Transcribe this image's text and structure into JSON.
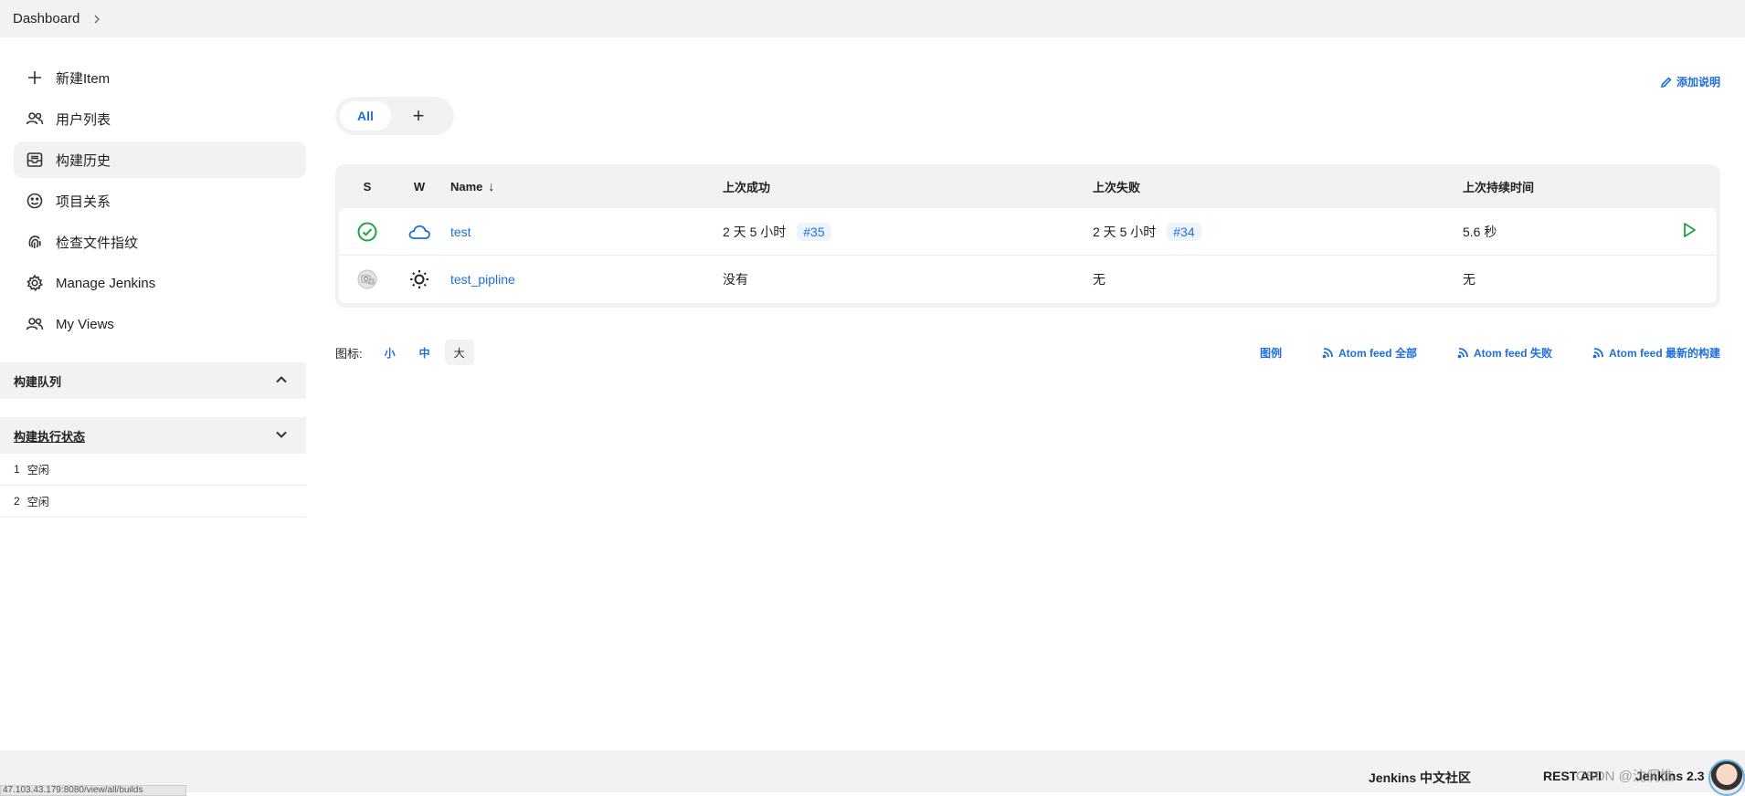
{
  "breadcrumb": {
    "root": "Dashboard",
    "separator": ">"
  },
  "sidebar": {
    "items": [
      {
        "label": "新建Item",
        "icon": "plus-icon"
      },
      {
        "label": "用户列表",
        "icon": "users-icon"
      },
      {
        "label": "构建历史",
        "icon": "inbox-icon",
        "active": true
      },
      {
        "label": "项目关系",
        "icon": "smile-icon"
      },
      {
        "label": "检查文件指纹",
        "icon": "fingerprint-icon"
      },
      {
        "label": "Manage Jenkins",
        "icon": "gear-icon"
      },
      {
        "label": "My Views",
        "icon": "users-icon"
      }
    ],
    "queue": {
      "title": "构建队列"
    },
    "executors": {
      "title": "构建执行状态",
      "rows": [
        {
          "num": "1",
          "status": "空闲"
        },
        {
          "num": "2",
          "status": "空闲"
        }
      ]
    }
  },
  "main": {
    "add_description": "添加说明",
    "tabs": {
      "all": "All",
      "add": "+"
    },
    "table": {
      "headers": {
        "s": "S",
        "w": "W",
        "name": "Name",
        "sort": "↓",
        "last_success": "上次成功",
        "last_failure": "上次失败",
        "last_duration": "上次持续时间"
      },
      "rows": [
        {
          "name": "test",
          "status": "success",
          "weather": "cloud",
          "last_success": "2 天 5 小时",
          "success_build": "#35",
          "last_failure": "2 天 5 小时",
          "failure_build": "#34",
          "duration": "5.6 秒"
        },
        {
          "name": "test_pipline",
          "status": "notbuilt",
          "weather": "sun",
          "last_success": "没有",
          "last_failure": "无",
          "duration": "无"
        }
      ]
    },
    "icon_size": {
      "label": "图标:",
      "options": [
        "小",
        "中",
        "大"
      ],
      "selected": "大"
    },
    "feeds": {
      "legend": "图例",
      "all": "Atom feed 全部",
      "failures": "Atom feed 失败",
      "latest": "Atom feed 最新的构建"
    }
  },
  "footer": {
    "community": "Jenkins 中文社区",
    "rest_api": "REST API",
    "version": "Jenkins 2.3"
  },
  "status_bar": {
    "url": "47.103.43.179:8080/view/all/builds"
  },
  "watermark": "CSDN @沈侗憔",
  "colors": {
    "accent": "#1e6fd9",
    "success": "#1ea446",
    "panel": "#f2f2f5"
  }
}
